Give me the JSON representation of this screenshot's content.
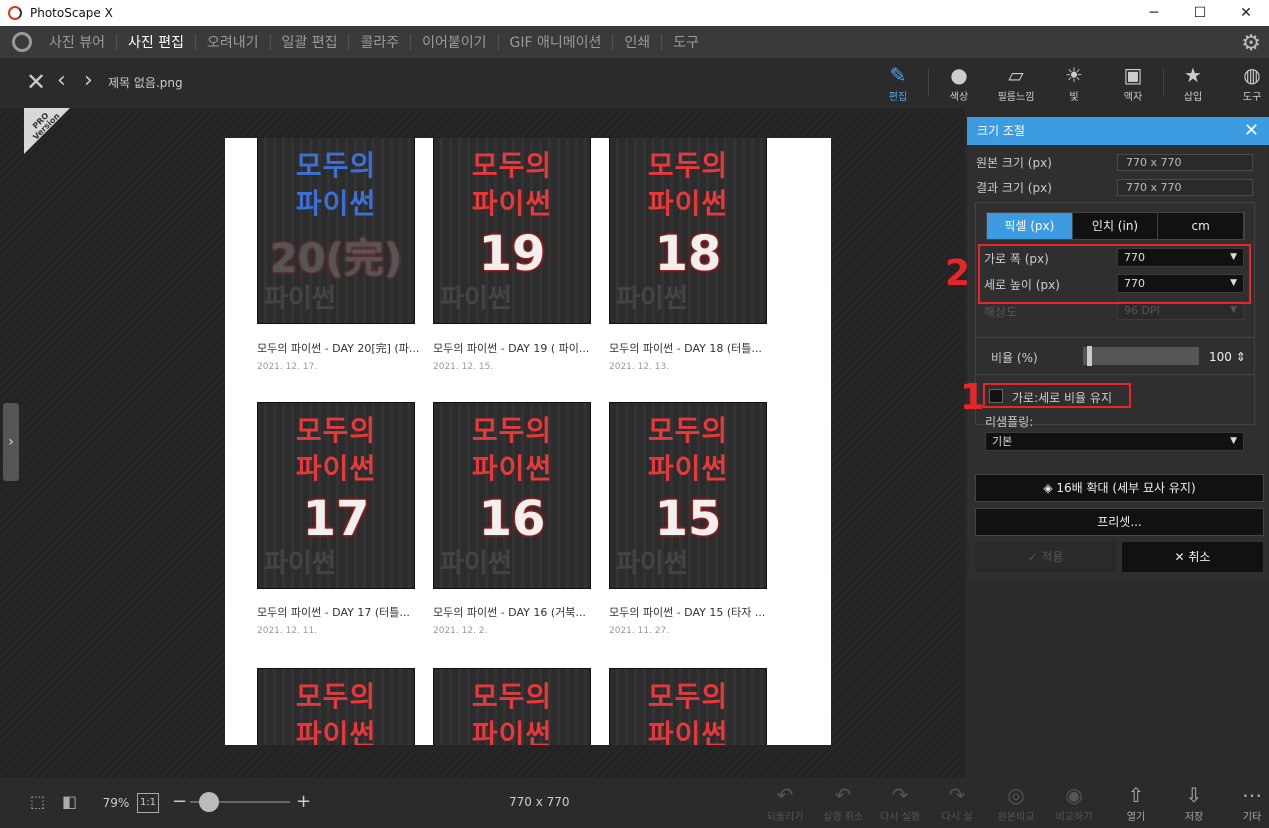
{
  "app": {
    "title": "PhotoScape X",
    "min": "─",
    "max": "☐",
    "close": "✕"
  },
  "menu": {
    "items": [
      "사진 뷰어",
      "사진 편집",
      "오려내기",
      "일괄 편집",
      "콜라주",
      "이어붙이기",
      "GIF 애니메이션",
      "인쇄",
      "도구"
    ],
    "active": "사진 편집"
  },
  "toolbar": {
    "filename": "제목 없음.png",
    "tools": [
      "편집",
      "색상",
      "필름느낌",
      "빛",
      "액자",
      "삽입",
      "도구"
    ],
    "active_tool": "편집"
  },
  "badge": {
    "pro": "PRO",
    "version": "Version"
  },
  "thumbs": [
    {
      "title": "모두의",
      "title2": "파이썬",
      "num": "20(完)",
      "caption": "모두의 파이썬 - DAY 20[完] (파...",
      "date": "2021. 12. 17.",
      "style": "blue"
    },
    {
      "title": "모두의",
      "title2": "파이썬",
      "num": "19",
      "caption": "모두의 파이썬 - DAY 19 ( 파이...",
      "date": "2021. 12. 15.",
      "style": "red"
    },
    {
      "title": "모두의",
      "title2": "파이썬",
      "num": "18",
      "caption": "모두의 파이썬 - DAY 18 (터틀...",
      "date": "2021. 12. 13.",
      "style": "red"
    },
    {
      "title": "모두의",
      "title2": "파이썬",
      "num": "17",
      "caption": "모두의 파이썬 - DAY 17 (터틀...",
      "date": "2021. 12. 11.",
      "style": "red"
    },
    {
      "title": "모두의",
      "title2": "파이썬",
      "num": "16",
      "caption": "모두의 파이썬 - DAY 16 (거북...",
      "date": "2021. 12. 2.",
      "style": "red"
    },
    {
      "title": "모두의",
      "title2": "파이썬",
      "num": "15",
      "caption": "모두의 파이썬 - DAY 15 (타자 ...",
      "date": "2021. 11. 27.",
      "style": "red"
    },
    {
      "title": "모두의",
      "title2": "파이썬",
      "num": "",
      "caption": "",
      "date": "",
      "style": "red"
    },
    {
      "title": "모두의",
      "title2": "파이썬",
      "num": "",
      "caption": "",
      "date": "",
      "style": "red"
    },
    {
      "title": "모두의",
      "title2": "파이썬",
      "num": "",
      "caption": "",
      "date": "",
      "style": "red"
    }
  ],
  "book_sub": "파이썬",
  "panel": {
    "title": "크기 조절",
    "orig_label": "원본 크기 (px)",
    "orig_value": "770 x 770",
    "result_label": "결과 크기 (px)",
    "result_value": "770 x 770",
    "units": [
      "픽셀 (px)",
      "인치 (in)",
      "cm"
    ],
    "active_unit": "픽셀 (px)",
    "width_label": "가로 폭 (px)",
    "width_value": "770",
    "height_label": "세로 높이 (px)",
    "height_value": "770",
    "dpi_label": "해상도",
    "dpi_value": "96 DPI",
    "ratio_label": "비율 (%)",
    "ratio_value": "100",
    "ratio_fraction": 0.02,
    "keep_ratio_label": "가로:세로 비율 유지",
    "keep_ratio_checked": false,
    "resample_label": "리샘플링:",
    "resample_value": "기본",
    "upscale_label": "16배 확대 (세부 묘사 유지)",
    "preset_label": "프리셋...",
    "apply_label": "적용",
    "cancel_label": "취소"
  },
  "annotations": {
    "one": "1",
    "two": "2"
  },
  "bottom": {
    "zoom": "79%",
    "one_to_one": "1:1",
    "image_size": "770 x 770",
    "actions": [
      "되돌리기",
      "실행 취소",
      "다시 실행",
      "다시 실",
      "원본비교",
      "비교하기",
      "열기",
      "저장",
      "기타"
    ]
  },
  "colors": {
    "accent": "#3d9be2",
    "annotation_red": "#e8262a"
  }
}
